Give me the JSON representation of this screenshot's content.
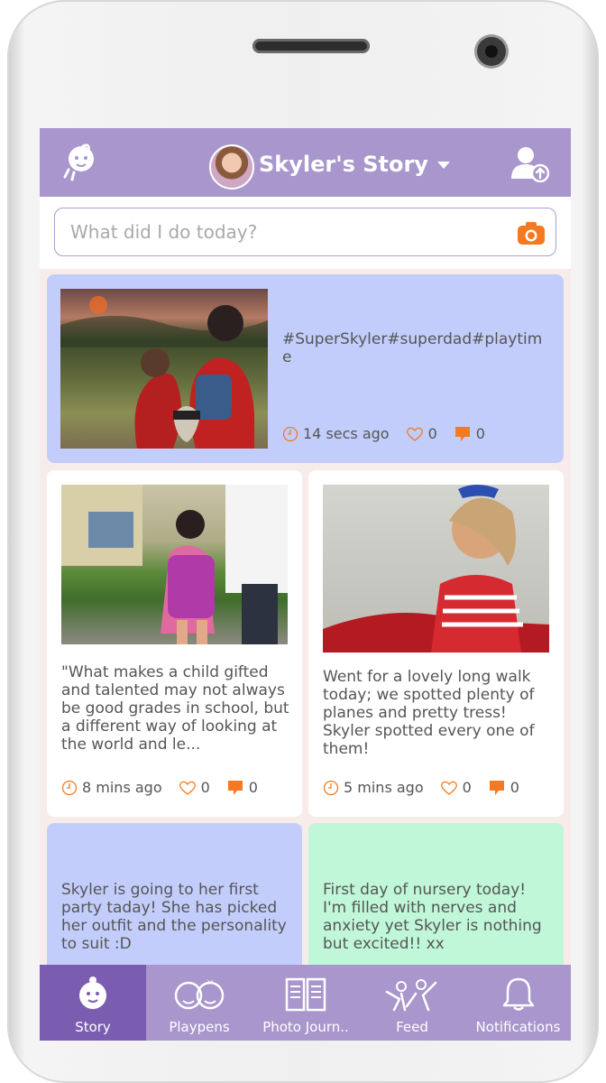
{
  "header": {
    "title": "Skyler's Story"
  },
  "composer": {
    "placeholder": "What did I do today?"
  },
  "posts": [
    {
      "text": "#SuperSkyler#superdad#playtime",
      "time": "14 secs ago",
      "likes": "0",
      "comments": "0"
    },
    {
      "text": "\"What makes a child gifted and talented may not always be good grades in school, but a different way of looking at the world and le...",
      "time": "8 mins ago",
      "likes": "0",
      "comments": "0"
    },
    {
      "text": "Went for a lovely long walk today; we spotted plenty of planes and pretty tress! Skyler spotted every one of them!",
      "time": "5 mins ago",
      "likes": "0",
      "comments": "0"
    },
    {
      "text": "Skyler is going to her first party taday! She has picked her outfit and the personality to suit :D"
    },
    {
      "text": "First day of nursery today! I'm filled with nerves and anxiety yet Skyler is nothing but excited!! xx"
    }
  ],
  "nav": [
    {
      "label": "Story",
      "icon": "baby-face-icon"
    },
    {
      "label": "Playpens",
      "icon": "two-kids-icon"
    },
    {
      "label": "Photo Journ..",
      "icon": "open-book-icon"
    },
    {
      "label": "Feed",
      "icon": "people-cheer-icon"
    },
    {
      "label": "Notifications",
      "icon": "bell-icon"
    }
  ],
  "colors": {
    "header": "#a896cc",
    "nav_active": "#7a5db1",
    "card_blue": "#c3cdfb",
    "card_green": "#bff7d8",
    "accent_orange": "#f47920"
  }
}
